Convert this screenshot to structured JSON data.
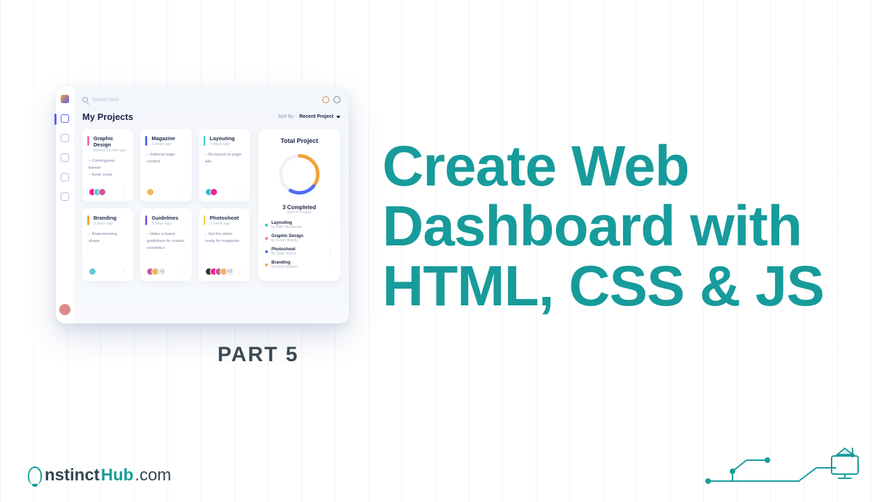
{
  "headline": "Create Web Dashboard with HTML, CSS & JS",
  "part_label": "PART 5",
  "brand": {
    "left": "nstinct",
    "hub": "Hub",
    "domain": ".com"
  },
  "mock": {
    "search_placeholder": "Search here",
    "title": "My Projects",
    "sort_label": "Sort By :",
    "sort_value": "Recent Project",
    "cards": [
      {
        "title": "Graphic Design",
        "subtitle": "Edited 19 min ago",
        "items": [
          "Comingsoon banner",
          "Book cover"
        ],
        "color": "c-pink",
        "avatars": [
          "a1",
          "a2",
          "a3"
        ],
        "more": ""
      },
      {
        "title": "Magazine",
        "subtitle": "2 days ago",
        "items": [
          "Editorial page content"
        ],
        "color": "c-blue",
        "avatars": [
          "a4"
        ],
        "more": ""
      },
      {
        "title": "Layouting",
        "subtitle": "2 days ago",
        "items": [
          "Re-layout on page ads"
        ],
        "color": "c-teal",
        "avatars": [
          "a6",
          "a1"
        ],
        "more": ""
      },
      {
        "title": "Branding",
        "subtitle": "3 days ago",
        "items": [
          "Brainstorming shape"
        ],
        "color": "c-orange",
        "avatars": [
          "a2"
        ],
        "more": ""
      },
      {
        "title": "Guidelines",
        "subtitle": "5 days ago",
        "items": [
          "Make a brand guidelines for maked cosmetics"
        ],
        "color": "c-purple",
        "avatars": [
          "a3",
          "a4"
        ],
        "more": "+2"
      },
      {
        "title": "Photoshoot",
        "subtitle": "1 week ago",
        "items": [
          "Set the photo ready for magazine"
        ],
        "color": "c-yellow",
        "avatars": [
          "a5",
          "a1",
          "a3",
          "a4"
        ],
        "more": "+3"
      }
    ],
    "side": {
      "title": "Total Project",
      "completed_label": "3 Completed",
      "from_label": "from 5 Project",
      "items": [
        {
          "title": "Layouting",
          "by": "by Millie Henderson",
          "dot": "c-teal"
        },
        {
          "title": "Graphic Design",
          "by": "by Susan Woods",
          "dot": "c-pink"
        },
        {
          "title": "Photoshoot",
          "by": "by Jorge Rivera",
          "dot": "c-blue"
        },
        {
          "title": "Branding",
          "by": "by Ethan Watson",
          "dot": "c-orange"
        }
      ]
    }
  }
}
